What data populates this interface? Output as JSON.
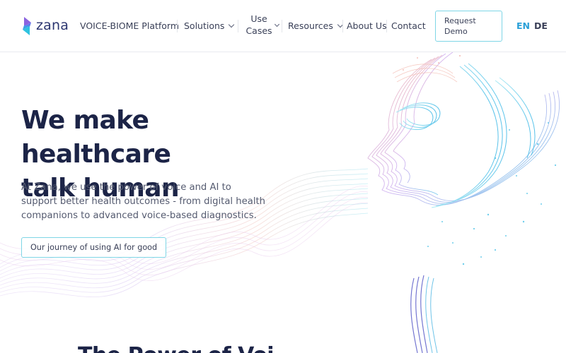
{
  "header": {
    "logo_text": "zana",
    "nav": {
      "platform": "VOICE-BIOME Platform",
      "solutions": "Solutions",
      "use_cases_line1": "Use",
      "use_cases_line2": "Cases",
      "resources": "Resources",
      "about": "About Us",
      "contact": "Contact"
    },
    "demo_button_line1": "Request",
    "demo_button_line2": "Demo",
    "languages": {
      "en": "EN",
      "de": "DE",
      "active": "EN"
    }
  },
  "hero": {
    "title_line1": "We make healthcare",
    "title_line2": "talk human",
    "description": "At Zana, we use the power of voice and AI to support better health outcomes - from digital health companions to advanced voice-based diagnostics.",
    "cta": "Our journey of using AI for good"
  },
  "next_section": {
    "title_partial": "The Power of Voi"
  },
  "colors": {
    "brand_navy": "#1c2447",
    "accent_cyan": "#7fd6e6",
    "accent_blue": "#2aa0d8",
    "logo_purple": "#7b5cd6"
  },
  "icons": [
    "zana-logo-icon",
    "chevron-down-icon"
  ]
}
